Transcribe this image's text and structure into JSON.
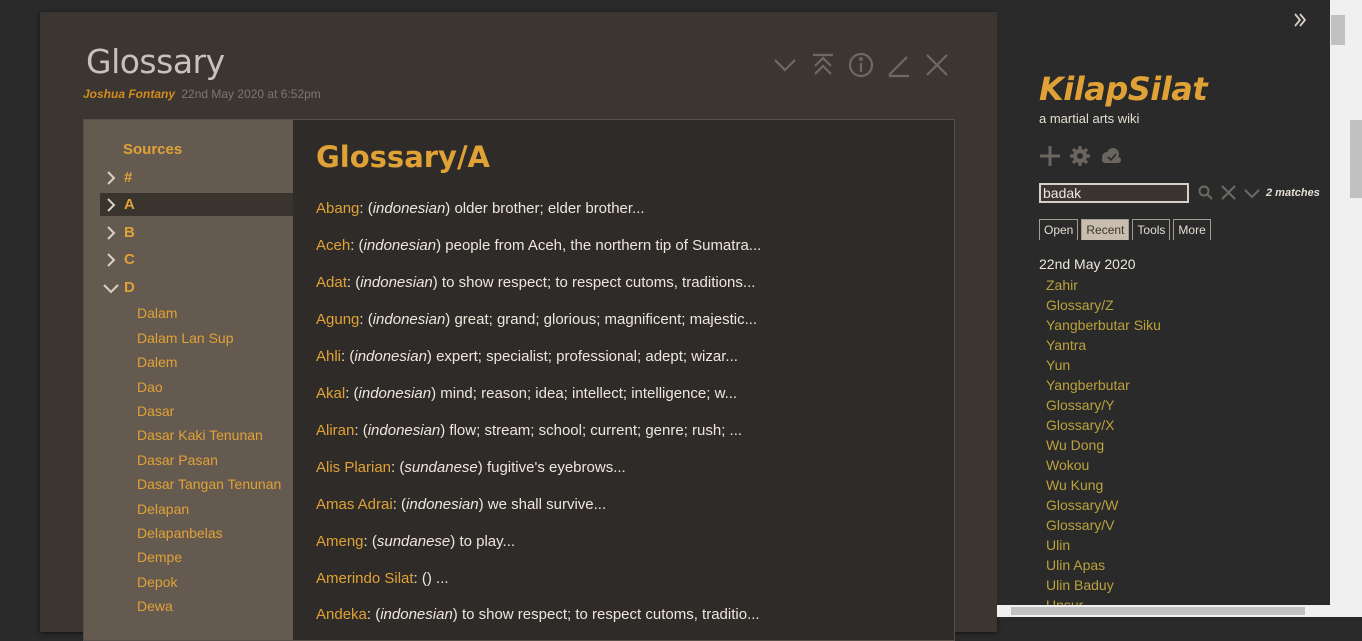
{
  "tiddler": {
    "title": "Glossary",
    "author": "Joshua Fontany",
    "date": "22nd May 2020 at 6:52pm",
    "controls": [
      "chevron-down-icon",
      "close-others-icon",
      "info-icon",
      "edit-icon",
      "close-icon"
    ]
  },
  "toc": {
    "heading": "Sources",
    "items": [
      {
        "label": "#",
        "state": "collapsed"
      },
      {
        "label": "A",
        "state": "collapsed",
        "selected": true
      },
      {
        "label": "B",
        "state": "collapsed"
      },
      {
        "label": "C",
        "state": "collapsed"
      },
      {
        "label": "D",
        "state": "expanded"
      }
    ],
    "sub_items": [
      "Dalam",
      "Dalam Lan Sup",
      "Dalem",
      "Dao",
      "Dasar",
      "Dasar Kaki Tenunan",
      "Dasar Pasan",
      "Dasar Tangan Tenunan",
      "Delapan",
      "Delapanbelas",
      "Dempe",
      "Depok",
      "Dewa"
    ]
  },
  "content": {
    "heading": "Glossary/A",
    "entries": [
      {
        "term": "Abang",
        "lang": "indonesian",
        "def": ") older brother; elder brother..."
      },
      {
        "term": "Aceh",
        "lang": "indonesian",
        "def": ") people from Aceh, the northern tip of Sumatra..."
      },
      {
        "term": "Adat",
        "lang": "indonesian",
        "def": ") to show respect; to respect cutoms, traditions..."
      },
      {
        "term": "Agung",
        "lang": "indonesian",
        "def": ") great; grand; glorious; magnificent; majestic..."
      },
      {
        "term": "Ahli",
        "lang": "indonesian",
        "def": ") expert; specialist; professional; adept; wizar..."
      },
      {
        "term": "Akal",
        "lang": "indonesian",
        "def": ") mind; reason; idea; intellect; intelligence; w..."
      },
      {
        "term": "Aliran",
        "lang": "indonesian",
        "def": ") flow; stream; school; current; genre; rush; ..."
      },
      {
        "term": "Alis Plarian",
        "lang": "sundanese",
        "def": ") fugitive's eyebrows..."
      },
      {
        "term": "Amas Adrai",
        "lang": "indonesian",
        "def": ") we shall survive..."
      },
      {
        "term": "Ameng",
        "lang": "sundanese",
        "def": ") to play..."
      },
      {
        "term": "Amerindo Silat",
        "lang": "",
        "def": "() ..."
      },
      {
        "term": "Andeka",
        "lang": "indonesian",
        "def": ") to show respect; to respect cutoms, traditio..."
      }
    ]
  },
  "sidebar": {
    "site_title": "KilapSilat",
    "site_subtitle": "a martial arts wiki",
    "buttons": [
      "plus-icon",
      "gear-icon",
      "cloud-icon"
    ],
    "search": {
      "value": "badak",
      "matches": "2 matches"
    },
    "tabs": [
      {
        "label": "Open",
        "active": false
      },
      {
        "label": "Recent",
        "active": true
      },
      {
        "label": "Tools",
        "active": false
      },
      {
        "label": "More",
        "active": false
      }
    ],
    "recent_date": "22nd May 2020",
    "recent_links": [
      "Zahir",
      "Glossary/Z",
      "Yangberbutar Siku",
      "Yantra",
      "Yun",
      "Yangberbutar",
      "Glossary/Y",
      "Glossary/X",
      "Wu Dong",
      "Wokou",
      "Wu Kung",
      "Glossary/W",
      "Glossary/V",
      "Ulin",
      "Ulin Apas",
      "Ulin Baduy",
      "Unsur"
    ]
  },
  "colors": {
    "accent": "#e0a236",
    "link": "#bba13c",
    "background": "#2a2a2a",
    "tiddler": "#3b3632",
    "toc": "#655a50"
  }
}
